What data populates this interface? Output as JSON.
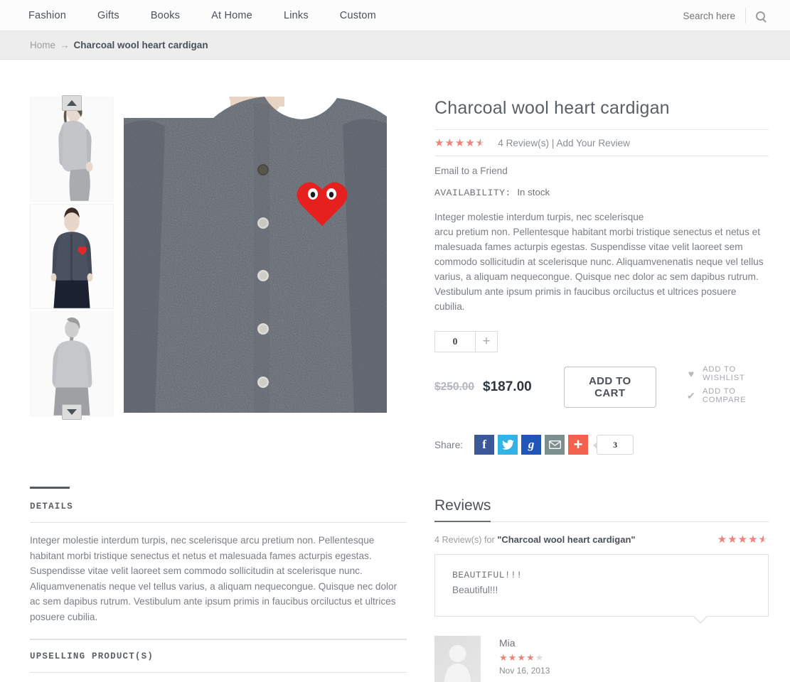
{
  "header": {
    "nav": [
      {
        "label": "Fashion"
      },
      {
        "label": "Gifts"
      },
      {
        "label": "Books"
      },
      {
        "label": "At Home"
      },
      {
        "label": "Links"
      },
      {
        "label": "Custom"
      }
    ],
    "search": {
      "placeholder": "Search here",
      "value": "",
      "icon": "search-icon"
    }
  },
  "breadcrumb": {
    "home": "Home",
    "arrow": "→",
    "current": "Charcoal wool heart cardigan"
  },
  "gallery": {
    "up_arrow": "scroll-up",
    "down_arrow": "scroll-down",
    "thumbnails": [
      {
        "alt": "Side view of model wearing grey cardigan"
      },
      {
        "alt": "Front view of model wearing charcoal cardigan"
      },
      {
        "alt": "Back view of model wearing grey cardigan"
      }
    ],
    "main_image_alt": "Close-up of charcoal wool cardigan with red heart patch"
  },
  "product": {
    "title": "Charcoal wool heart cardigan",
    "rating": 4.5,
    "rating_max": 5,
    "review_count_label": "4 Review(s)",
    "separator": "|",
    "add_review_label": "Add Your Review",
    "email_friend_label": "Email to a Friend",
    "availability_label": "AVAILABILITY:",
    "availability_value": "In stock",
    "short_description": "Integer molestie interdum turpis, nec scelerisque\narcu pretium non. Pellentesque habitant morbi tristique senectus et netus et malesuada fames acturpis egestas. Suspendisse vitae velit laoreet sem\ncommodo sollicitudin at scelerisque nunc. Aliquamvenenatis neque vel tellus varius, a aliquam nequecongue. Quisque nec dolor ac sem dapibus rutrum.\nVestibulum ante ipsum primis in faucibus orciluctus et ultrices posuere cubilia.",
    "quantity": "0",
    "quantity_plus": "+",
    "price_old": "$250.00",
    "price_new": "$187.00",
    "add_to_cart_label": "ADD TO CART",
    "wishlist_label": "ADD TO WISHLIST",
    "wishlist_icon": "heart-icon",
    "compare_label": "ADD TO COMPARE",
    "compare_icon": "check-icon"
  },
  "share": {
    "label": "Share:",
    "buttons": [
      {
        "name": "facebook",
        "glyph": "f",
        "color": "#3b5998"
      },
      {
        "name": "twitter",
        "glyph": "🐦",
        "color": "#32b3e5"
      },
      {
        "name": "google-plus",
        "glyph": "g",
        "color": "#2156b8"
      },
      {
        "name": "email",
        "glyph": "✉",
        "color": "#7d8e8e"
      },
      {
        "name": "addthis",
        "glyph": "+",
        "color": "#f2624c"
      }
    ],
    "count": "3"
  },
  "accordion": {
    "details_title": "DETAILS",
    "details_body": "Integer molestie interdum turpis, nec scelerisque arcu pretium non. Pellentesque habitant morbi tristique senectus et netus et malesuada fames acturpis egestas. Suspendisse vitae velit laoreet sem commodo sollicitudin at scelerisque nunc. Aliquamvenenatis neque vel tellus varius, a aliquam nequecongue. Quisque nec dolor ac sem dapibus rutrum. Vestibulum ante ipsum primis in faucibus orciluctus et ultrices posuere cubilia.",
    "upselling_title": "UPSELLING PRODUCT(S)"
  },
  "reviews": {
    "heading": "Reviews",
    "summary_count": "4 Review(s) for ",
    "summary_product": "\"Charcoal wool heart cardigan\"",
    "summary_rating": 4.5,
    "items": [
      {
        "title": "BEAUTIFUL!!!",
        "body": "Beautiful!!!",
        "author": "Mia",
        "rating": 4,
        "date": "Nov 16, 2013"
      }
    ]
  },
  "colors": {
    "accent": "#ef8279",
    "star_empty": "#dcdcdc",
    "text": "#7a7f85",
    "heading": "#4b5159",
    "breadcrumb_bg": "#ededed"
  }
}
